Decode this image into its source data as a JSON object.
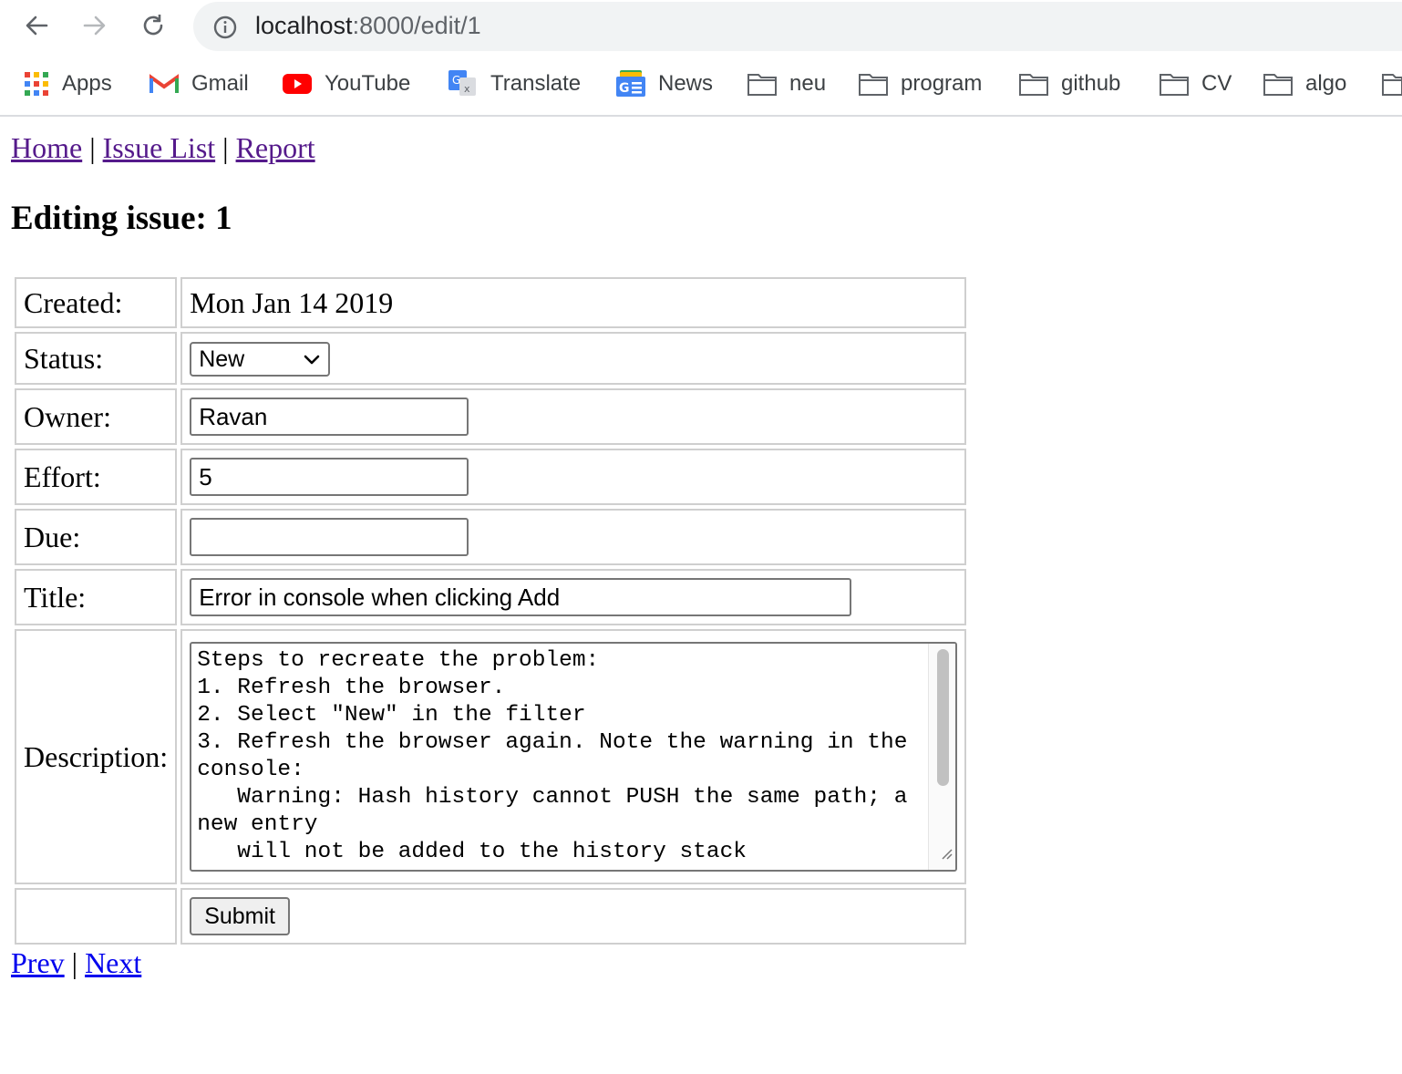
{
  "browser": {
    "url_host": "localhost",
    "url_path": ":8000/edit/1",
    "bookmarks": [
      {
        "label": "Apps",
        "icon": "apps-grid-icon"
      },
      {
        "label": "Gmail",
        "icon": "gmail-icon"
      },
      {
        "label": "YouTube",
        "icon": "youtube-icon"
      },
      {
        "label": "Translate",
        "icon": "translate-icon"
      },
      {
        "label": "News",
        "icon": "news-icon"
      },
      {
        "label": "neu",
        "icon": "folder-icon"
      },
      {
        "label": "program",
        "icon": "folder-icon"
      },
      {
        "label": "github",
        "icon": "folder-icon"
      },
      {
        "label": "CV",
        "icon": "folder-icon"
      },
      {
        "label": "algo",
        "icon": "folder-icon"
      }
    ]
  },
  "nav": {
    "home": "Home",
    "issue_list": "Issue List",
    "report": "Report",
    "separator": "|"
  },
  "heading": "Editing issue: 1",
  "form": {
    "created_label": "Created:",
    "created_value": "Mon Jan 14 2019",
    "status_label": "Status:",
    "status_value": "New",
    "owner_label": "Owner:",
    "owner_value": "Ravan",
    "effort_label": "Effort:",
    "effort_value": "5",
    "due_label": "Due:",
    "due_value": "",
    "title_label": "Title:",
    "title_value": "Error in console when clicking Add",
    "description_label": "Description:",
    "description_value": "Steps to recreate the problem:\n1. Refresh the browser.\n2. Select \"New\" in the filter\n3. Refresh the browser again. Note the warning in the console:\n   Warning: Hash history cannot PUSH the same path; a new entry\n   will not be added to the history stack",
    "submit_label": "Submit"
  },
  "pager": {
    "prev": "Prev",
    "next": "Next",
    "separator": "|"
  },
  "colors": {
    "visited_link": "#551a8b",
    "link": "#0000ee",
    "border": "#cfcfcf"
  }
}
